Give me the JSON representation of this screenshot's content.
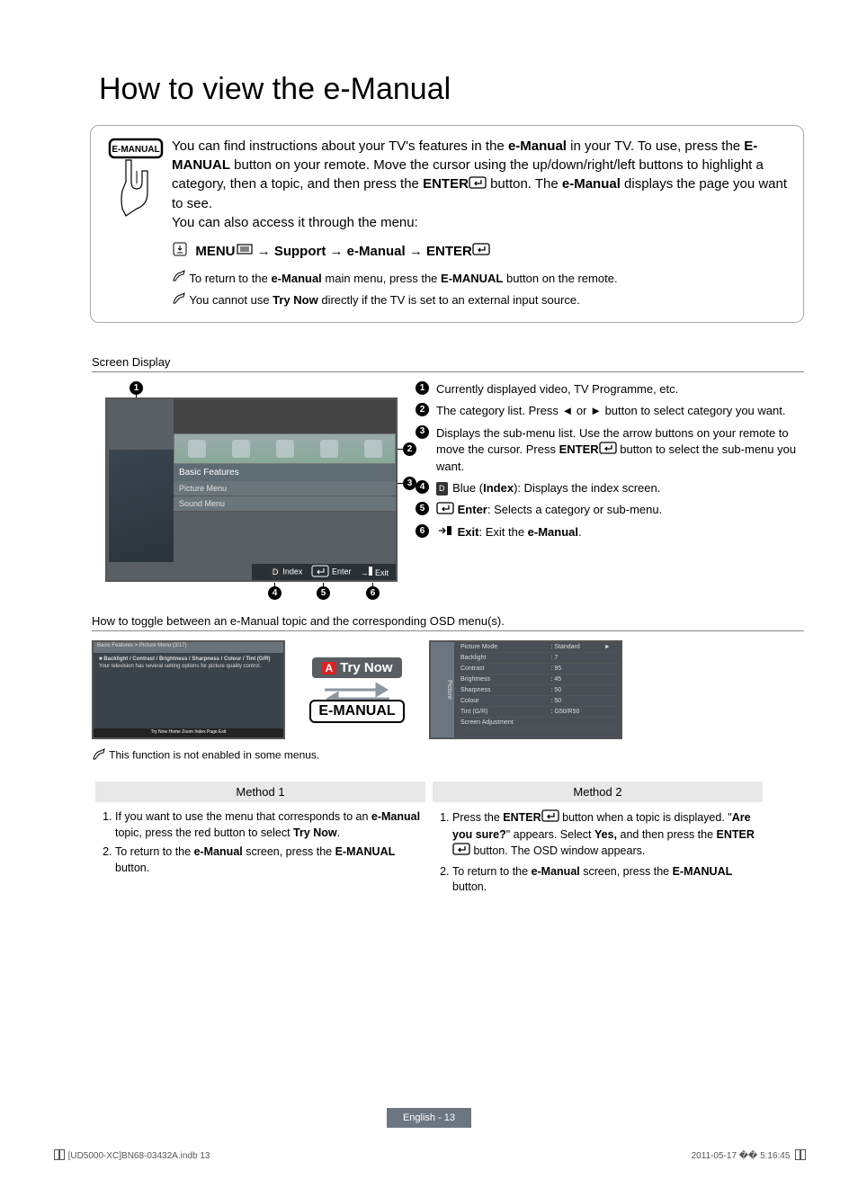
{
  "title": "How to view the e-Manual",
  "intro": {
    "remote_label": "E-MANUAL",
    "para1_a": "You can find instructions about your TV's features in the ",
    "para1_b": "e-Manual",
    "para1_c": " in your TV. To use, press the ",
    "para1_d": "E-MANUAL",
    "para1_e": " button on your remote. Move the cursor using the up/down/right/left buttons to highlight a category, then a topic, and then press the ",
    "para1_f": "ENTER",
    "para1_g": " button. The ",
    "para1_h": "e-Manual",
    "para1_i": " displays the page you want to see.",
    "para2": "You can also access it through the menu:",
    "menu_path": {
      "m": "MENU",
      "a": "→ Support → e-Manual →",
      "e": "ENTER"
    },
    "note1_a": "To return to the ",
    "note1_b": "e-Manual",
    "note1_c": " main menu, press the ",
    "note1_d": "E-MANUAL",
    "note1_e": " button on the remote.",
    "note2_a": "You cannot use ",
    "note2_b": "Try Now",
    "note2_c": " directly if the TV is set to an external input source."
  },
  "screen_heading": "Screen Display",
  "tv": {
    "category": "Basic Features",
    "sub1": "Picture Menu",
    "sub2": "Sound Menu",
    "foot_index": "Index",
    "foot_enter": "Enter",
    "foot_exit": "Exit"
  },
  "legend": {
    "1": "Currently displayed video, TV Programme, etc.",
    "2a": "The category list. Press ◄ or ► button to select category you want.",
    "3a": "Displays the sub-menu list. Use the arrow buttons on your remote to move the cursor. Press ",
    "3b": "ENTER",
    "3c": " button to select the sub-menu you want.",
    "4a": "Blue (",
    "4b": "Index",
    "4c": "): Displays the index screen.",
    "5a": "Enter",
    "5b": ": Selects a category or sub-menu.",
    "6a": "Exit",
    "6b": ": Exit the ",
    "6c": "e-Manual",
    "6d": "."
  },
  "toggle_heading": "How to toggle between an e-Manual topic and the corresponding OSD menu(s).",
  "mini1": {
    "hdr": "Basic Features > Picture Menu (3/17)",
    "line1": "■ Backlight / Contrast / Brightness / Sharpness / Colour / Tint (G/R)",
    "line2": "Your television has several setting options for picture quality control.",
    "ftr": "Try Now   Home   Zoom   Index   Page   Exit"
  },
  "trynow": {
    "a": "A",
    "label": "Try Now"
  },
  "emanual_btn": "E-MANUAL",
  "osd": {
    "side": "Picture",
    "rows": [
      {
        "k": "Picture Mode",
        "v": ": Standard",
        "arrow": "►"
      },
      {
        "k": "Backlight",
        "v": ": 7"
      },
      {
        "k": "Contrast",
        "v": ": 95"
      },
      {
        "k": "Brightness",
        "v": ": 45"
      },
      {
        "k": "Sharpness",
        "v": ": 50"
      },
      {
        "k": "Colour",
        "v": ": 50"
      },
      {
        "k": "Tint (G/R)",
        "v": ": G50/R50"
      },
      {
        "k": "Screen Adjustment",
        "v": ""
      }
    ]
  },
  "func_note": "This function is not enabled in some menus.",
  "method1_h": "Method 1",
  "method2_h": "Method 2",
  "method1": {
    "s1a": "If you want to use the menu that corresponds to an ",
    "s1b": "e-Manual",
    "s1c": " topic, press the red button to select ",
    "s1d": "Try Now",
    "s1e": ".",
    "s2a": "To return to the ",
    "s2b": "e-Manual",
    "s2c": " screen, press the ",
    "s2d": "E-MANUAL",
    "s2e": " button."
  },
  "method2": {
    "s1a": "Press the ",
    "s1b": "ENTER",
    "s1c": " button when a topic is displayed. \"",
    "s1d": "Are you sure?",
    "s1e": "\" appears. Select ",
    "s1f": "Yes,",
    "s1g": " and then press the ",
    "s1h": "ENTER",
    "s1i": " button. The OSD window appears.",
    "s2a": "To return to the ",
    "s2b": "e-Manual",
    "s2c": " screen, press the ",
    "s2d": "E-MANUAL",
    "s2e": " button."
  },
  "pagefoot": "English - 13",
  "docfoot": {
    "left": "[UD5000-XC]BN68-03432A.indb   13",
    "right": "2011-05-17   �� 5:16:45"
  }
}
